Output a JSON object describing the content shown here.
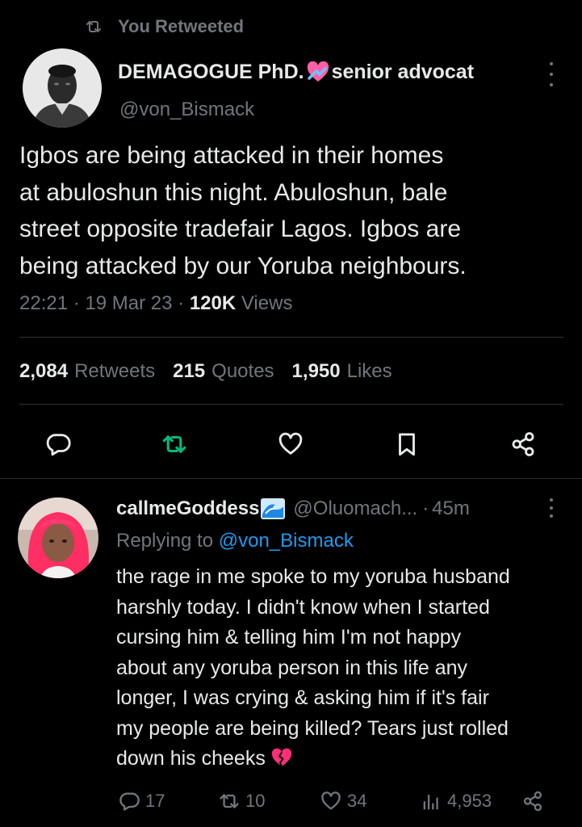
{
  "retweet_header": {
    "icon": "retweet-icon",
    "label": "You Retweeted"
  },
  "main_tweet": {
    "avatar": "profile-photo",
    "display_name": "DEMAGOGUE PhD.",
    "name_emoji": "heart-with-ribbon-emoji",
    "name_suffix": "senior advocat",
    "handle": "@von_Bismack",
    "text": "Igbos are being attacked in their  homes\nat abuloshun this night. Abuloshun, bale\nstreet opposite tradefair Lagos. Igbos are\nbeing attacked by our Yoruba neighbours.",
    "time": "22:21",
    "date": "19 Mar 23",
    "views_count": "120K",
    "views_label": "Views",
    "separator": "·",
    "stats": [
      {
        "count": "2,084",
        "label": "Retweets"
      },
      {
        "count": "215",
        "label": "Quotes"
      },
      {
        "count": "1,950",
        "label": "Likes"
      }
    ],
    "actions": [
      "reply-icon",
      "retweet-icon",
      "like-icon",
      "bookmark-icon",
      "share-icon"
    ],
    "retweet_active_color": "#00ba7c"
  },
  "reply": {
    "avatar": "profile-photo",
    "display_name": "callmeGoddess",
    "name_emoji": "water-wave-emoji",
    "handle": "@Oluomach...",
    "age": "45m",
    "separator": "·",
    "replying_prefix": "Replying to",
    "replying_to": "@von_Bismack",
    "text": "the rage in me spoke to my yoruba husband\nharshly today. I didn't know when I started\ncursing him & telling him I'm not happy\nabout any yoruba person in this life any\nlonger, I was crying & asking him if it's fair\nmy people are being killed? Tears just rolled\ndown his cheeks",
    "text_emoji": "broken-heart-emoji",
    "actions": {
      "replies": "17",
      "retweets": "10",
      "likes": "34",
      "views": "4,953"
    }
  },
  "colors": {
    "background": "#000000",
    "text": "#e7e9ea",
    "muted": "#71767b",
    "link": "#1d9bf0",
    "divider": "#2f3336"
  }
}
